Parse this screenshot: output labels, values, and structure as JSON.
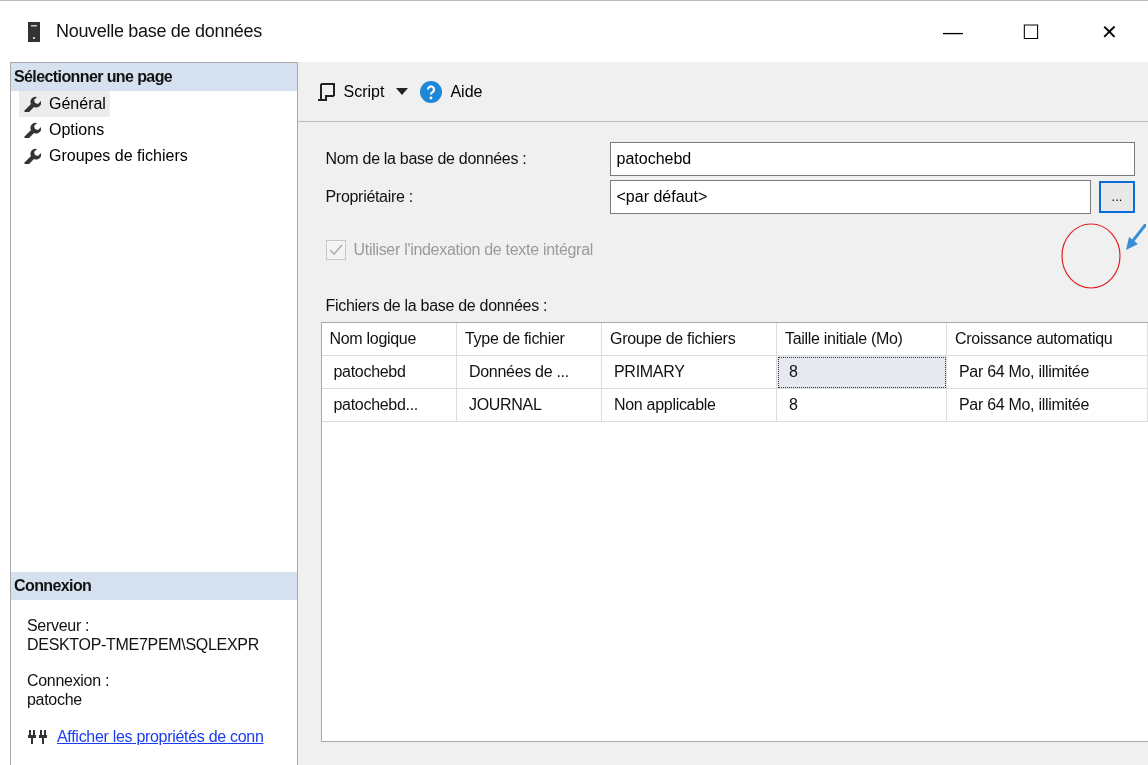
{
  "window": {
    "title": "Nouvelle base de données",
    "controls": [
      "—",
      "☐",
      "✕"
    ]
  },
  "sidebar": {
    "title": "Sélectionner une page",
    "items": [
      {
        "label": "Général",
        "selected": true
      },
      {
        "label": "Options",
        "selected": false
      },
      {
        "label": "Groupes de fichiers",
        "selected": false
      }
    ]
  },
  "connection": {
    "title": "Connexion",
    "server_label": "Serveur :",
    "server": "DESKTOP-TME7PEM\\SQLEXPR",
    "login_label": "Connexion :",
    "login": "patoche",
    "link": "Afficher les propriétés de conn"
  },
  "toolbar": {
    "script": "Script",
    "help": "Aide"
  },
  "form": {
    "name_label": "Nom de la base de données :",
    "name_value": "patochebd",
    "owner_label": "Propriétaire :",
    "owner_value": "<par défaut>",
    "browse": "...",
    "fulltext": {
      "label": "Utiliser l'indexation de texte intégral",
      "checked": true,
      "disabled": true
    }
  },
  "files": {
    "label": "Fichiers de la base de données :",
    "columns": [
      "Nom logique",
      "Type de fichier",
      "Groupe de fichiers",
      "Taille initiale (Mo)",
      "Croissance automatiqu"
    ],
    "rows": [
      {
        "cells": [
          {
            "text": "patochebd",
            "focused": false
          },
          {
            "text": "Données de ...",
            "focused": false
          },
          {
            "text": "PRIMARY",
            "focused": false
          },
          {
            "text": "8",
            "focused": true
          },
          {
            "text": "Par 64 Mo, illimitée",
            "focused": false
          }
        ]
      },
      {
        "cells": [
          {
            "text": "patochebd...",
            "focused": false
          },
          {
            "text": "JOURNAL",
            "focused": false
          },
          {
            "text": "Non applicable",
            "focused": false
          },
          {
            "text": "8",
            "focused": false
          },
          {
            "text": "Par 64 Mo, illimitée",
            "focused": false
          }
        ]
      }
    ]
  }
}
